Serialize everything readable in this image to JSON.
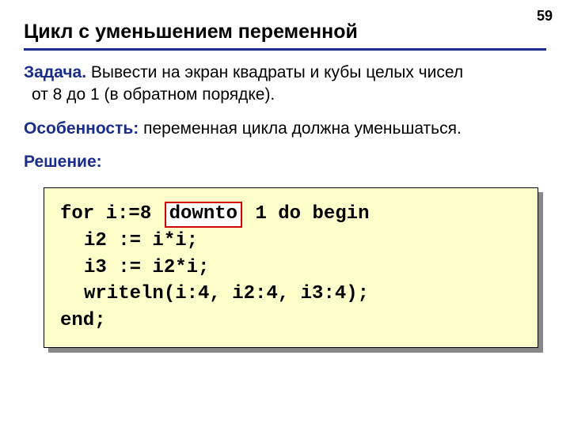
{
  "page_number": "59",
  "title": "Цикл с уменьшением переменной",
  "task_label": "Задача.",
  "task_text_1": " Вывести на экран квадраты и кубы целых чисел",
  "task_text_2": "от 8 до 1 (в обратном порядке).",
  "feature_label": "Особенность:",
  "feature_text": " переменная цикла должна уменьшаться.",
  "solution_label": "Решение:",
  "code": {
    "l1a": "for i:=8 ",
    "l1_hl": "downto",
    "l1b": " 1 do begin",
    "l2": "i2 := i*i;",
    "l3": "i3 := i2*i;",
    "l4": "writeln(i:4, i2:4, i3:4);",
    "l5": "end;"
  }
}
